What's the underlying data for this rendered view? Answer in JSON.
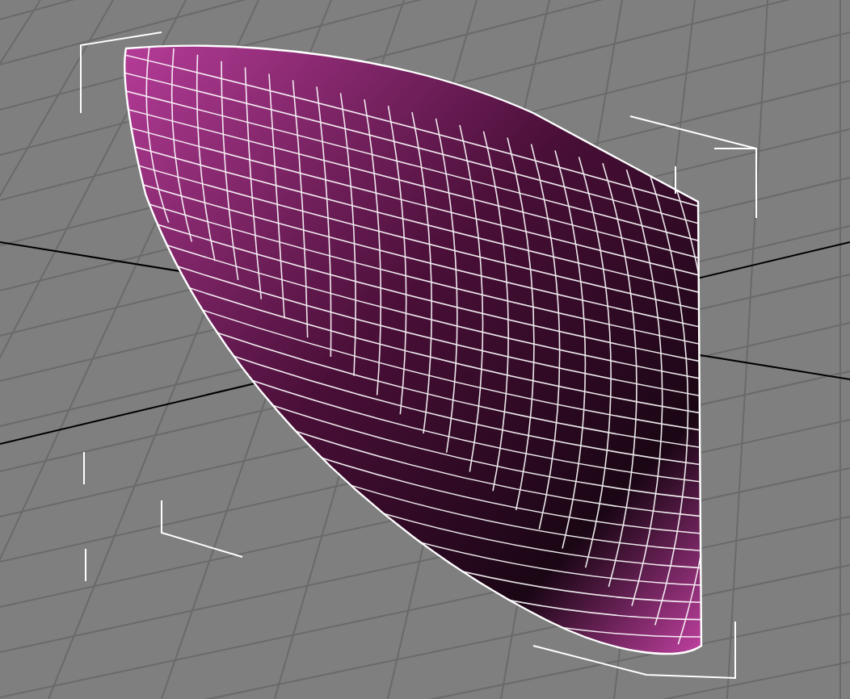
{
  "viewport": {
    "kind": "perspective",
    "selected": true
  }
}
